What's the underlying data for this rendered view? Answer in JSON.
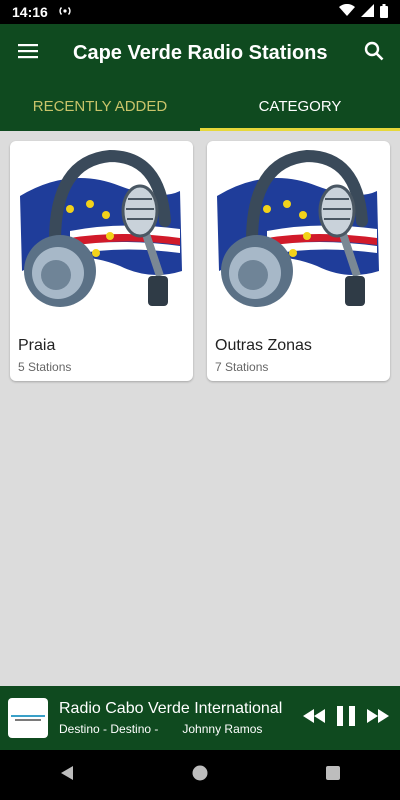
{
  "status_bar": {
    "time": "14:16",
    "icons": [
      "radio-broadcast-icon",
      "wifi-icon",
      "signal-icon",
      "battery-icon"
    ]
  },
  "app_bar": {
    "title": "Cape Verde Radio Stations",
    "menu_icon": "menu-icon",
    "search_icon": "search-icon"
  },
  "tabs": [
    {
      "label": "RECENTLY ADDED",
      "selected": false
    },
    {
      "label": "CATEGORY",
      "selected": true
    }
  ],
  "categories": [
    {
      "name": "Praia",
      "count": "5 Stations",
      "image": "cape-verde-flag-headphones"
    },
    {
      "name": "Outras Zonas",
      "count": "7 Stations",
      "image": "cape-verde-flag-headphones"
    }
  ],
  "player": {
    "station": "Radio Cabo Verde International",
    "track": "Destino - Destino -",
    "artist": "Johnny Ramos",
    "controls": [
      "rewind-icon",
      "pause-icon",
      "fast-forward-icon"
    ]
  },
  "colors": {
    "primary": "#0f4a1f",
    "tab_indicator": "#e6d83a",
    "tab_inactive_text": "#c9c46a",
    "background": "#dcdcdc",
    "flag_blue": "#1f3d9a",
    "flag_red": "#d11a2a"
  }
}
